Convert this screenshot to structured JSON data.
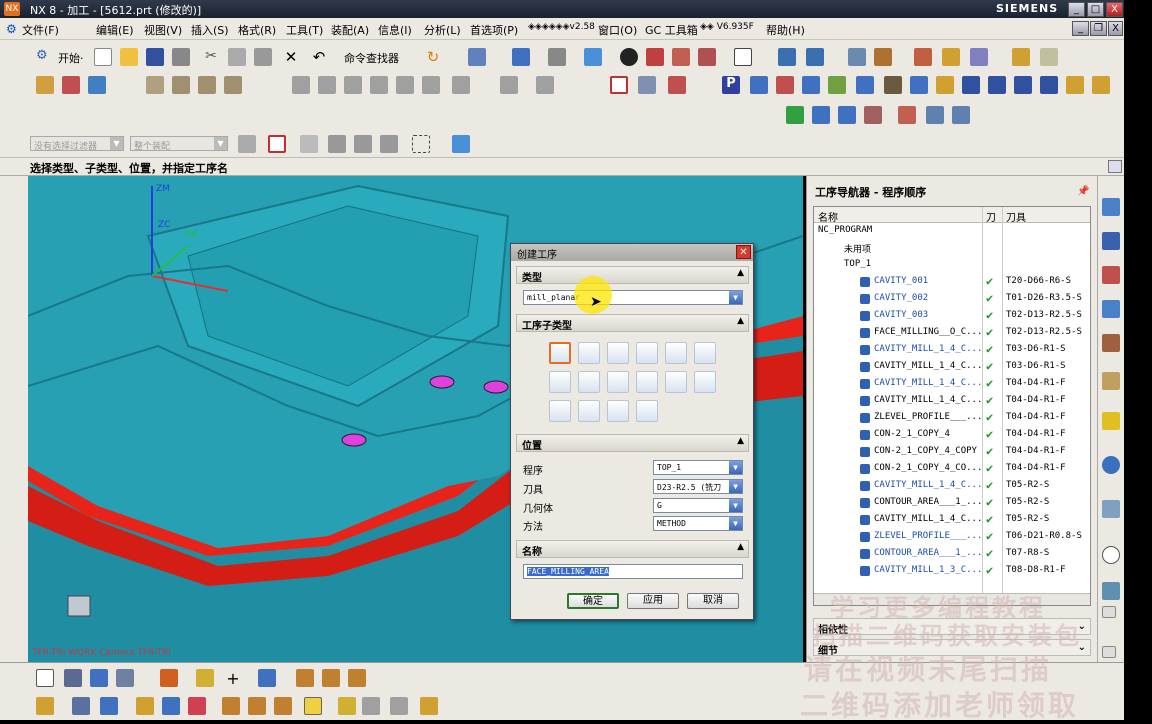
{
  "window": {
    "title": "NX 8 - 加工 - [5612.prt (修改的)]",
    "brand": "SIEMENS",
    "min": "_",
    "max": "□",
    "close": "X"
  },
  "menu": [
    "文件(F)",
    "编辑(E)",
    "视图(V)",
    "插入(S)",
    "格式(R)",
    "工具(T)",
    "装配(A)",
    "信息(I)",
    "分析(L)",
    "首选项(P)",
    "◈◈◈◈◈◈v2.58",
    "窗口(O)",
    "GC 工具箱",
    "◈◈ V6.935F",
    "帮助(H)"
  ],
  "toolbar": {
    "start": "开始·",
    "cmd_finder": "命令查找器"
  },
  "selection": {
    "filter": "没有选择过滤器",
    "scope": "整个装配"
  },
  "status": "选择类型、子类型、位置，并指定工序名",
  "viewport": {
    "camera_label": "TFR-TRI WORK Camera TFR-TRI",
    "axis_zm": "ZM",
    "axis_zc": "ZC",
    "axis_ym": "YM"
  },
  "dialog": {
    "title": "创建工序",
    "type_section": "类型",
    "type_value": "mill_planar",
    "subtype_section": "工序子类型",
    "location_section": "位置",
    "program_label": "程序",
    "program_value": "TOP_1",
    "tool_label": "刀具",
    "tool_value": "D23-R2.5 (铣刀",
    "geometry_label": "几何体",
    "geometry_value": "G",
    "method_label": "方法",
    "method_value": "METHOD",
    "name_section": "名称",
    "name_value": "FACE_MILLING_AREA",
    "ok": "确定",
    "apply": "应用",
    "cancel": "取消"
  },
  "navigator": {
    "title": "工序导航器 - 程序顺序",
    "columns": {
      "name": "名称",
      "tool_change": "刀",
      "tool": "刀具"
    },
    "rows": [
      {
        "name": "NC_PROGRAM",
        "tool": "",
        "chk": "",
        "x": 4,
        "blue": false
      },
      {
        "name": "未用项",
        "tool": "",
        "chk": "",
        "x": 30,
        "blue": false
      },
      {
        "name": "TOP_1",
        "tool": "",
        "chk": "",
        "x": 30,
        "blue": false
      },
      {
        "name": "CAVITY_001",
        "tool": "T20-D66-R6-S",
        "chk": "✔",
        "x": 60,
        "blue": true
      },
      {
        "name": "CAVITY_002",
        "tool": "T01-D26-R3.5-S",
        "chk": "✔",
        "x": 60,
        "blue": true
      },
      {
        "name": "CAVITY_003",
        "tool": "T02-D13-R2.5-S",
        "chk": "✔",
        "x": 60,
        "blue": true
      },
      {
        "name": "FACE_MILLING__O_C...",
        "tool": "T02-D13-R2.5-S",
        "chk": "✔",
        "x": 60,
        "blue": false
      },
      {
        "name": "CAVITY_MILL_1_4_C...",
        "tool": "T03-D6-R1-S",
        "chk": "✔",
        "x": 60,
        "blue": true
      },
      {
        "name": "CAVITY_MILL_1_4_C...",
        "tool": "T03-D6-R1-S",
        "chk": "✔",
        "x": 60,
        "blue": false
      },
      {
        "name": "CAVITY_MILL_1_4_C...",
        "tool": "T04-D4-R1-F",
        "chk": "✔",
        "x": 60,
        "blue": true
      },
      {
        "name": "CAVITY_MILL_1_4_C...",
        "tool": "T04-D4-R1-F",
        "chk": "✔",
        "x": 60,
        "blue": false
      },
      {
        "name": "ZLEVEL_PROFILE___...",
        "tool": "T04-D4-R1-F",
        "chk": "✔",
        "x": 60,
        "blue": false
      },
      {
        "name": "CON-2_1_COPY_4",
        "tool": "T04-D4-R1-F",
        "chk": "✔",
        "x": 60,
        "blue": false
      },
      {
        "name": "CON-2_1_COPY_4_COPY",
        "tool": "T04-D4-R1-F",
        "chk": "✔",
        "x": 60,
        "blue": false
      },
      {
        "name": "CON-2_1_COPY_4_CO...",
        "tool": "T04-D4-R1-F",
        "chk": "✔",
        "x": 60,
        "blue": false
      },
      {
        "name": "CAVITY_MILL_1_4_C...",
        "tool": "T05-R2-S",
        "chk": "✔",
        "x": 60,
        "blue": true
      },
      {
        "name": "CONTOUR_AREA___1_...",
        "tool": "T05-R2-S",
        "chk": "✔",
        "x": 60,
        "blue": false
      },
      {
        "name": "CAVITY_MILL_1_4_C...",
        "tool": "T05-R2-S",
        "chk": "✔",
        "x": 60,
        "blue": false
      },
      {
        "name": "ZLEVEL_PROFILE___...",
        "tool": "T06-D21-R0.8-S",
        "chk": "✔",
        "x": 60,
        "blue": true
      },
      {
        "name": "CONTOUR_AREA___1_...",
        "tool": "T07-R8-S",
        "chk": "✔",
        "x": 60,
        "blue": true
      },
      {
        "name": "CAVITY_MILL_1_3_C...",
        "tool": "T08-D8-R1-F",
        "chk": "✔",
        "x": 60,
        "blue": true
      }
    ],
    "dependency": "相依性",
    "details": "细节"
  },
  "watermark": [
    "学习更多编程教程",
    "扫描二维码获取安装包",
    "请在视频末尾扫描",
    "二维码添加老师领取"
  ],
  "colors": {
    "viewport": "#29a2b6",
    "red_part": "#e8241a",
    "marker": "#e040e0"
  }
}
